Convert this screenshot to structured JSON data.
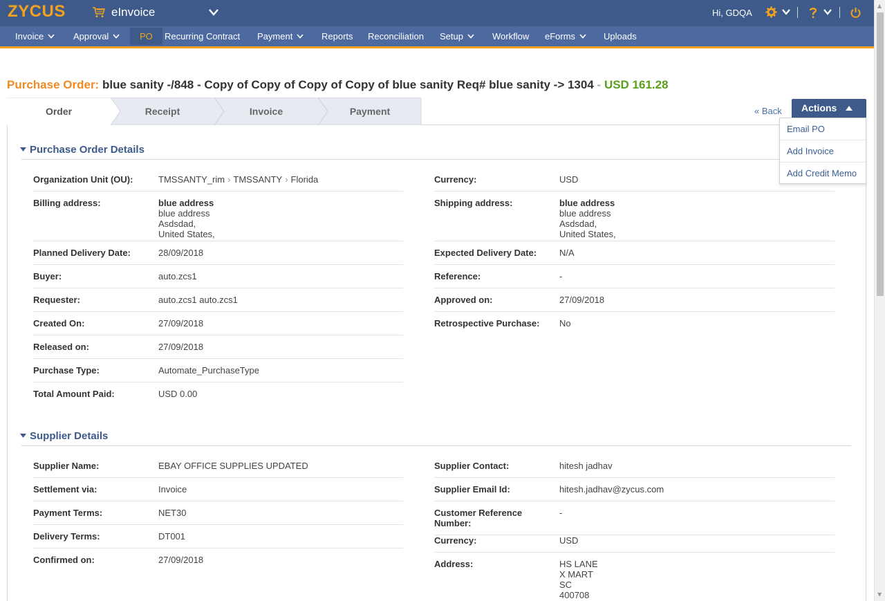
{
  "header": {
    "logo": "ZYCUS",
    "product": "eInvoice",
    "greeting": "Hi, GDQA"
  },
  "nav": {
    "items": [
      {
        "label": "Invoice"
      },
      {
        "label": "Approval"
      },
      {
        "label": "PO"
      },
      {
        "label": "Recurring Contract"
      },
      {
        "label": "Payment"
      },
      {
        "label": "Reports"
      },
      {
        "label": "Reconciliation"
      },
      {
        "label": "Setup"
      },
      {
        "label": "Workflow"
      },
      {
        "label": "eForms"
      },
      {
        "label": "Uploads"
      }
    ]
  },
  "title": {
    "label": "Purchase Order:",
    "name": "blue sanity -/848 - Copy of Copy of Copy of Copy of blue sanity Req# blue sanity -> 1304",
    "separator": "-",
    "amount": "USD 161.28"
  },
  "tabs": [
    {
      "label": "Order"
    },
    {
      "label": "Receipt"
    },
    {
      "label": "Invoice"
    },
    {
      "label": "Payment"
    }
  ],
  "back_link": "« Back",
  "actions": {
    "label": "Actions",
    "menu": [
      {
        "label": "Email PO"
      },
      {
        "label": "Add Invoice"
      },
      {
        "label": "Add Credit Memo"
      }
    ]
  },
  "po_details": {
    "heading": "Purchase Order Details",
    "org_unit": {
      "label": "Organization Unit (OU):",
      "parts": [
        "TMSSANTY_rim",
        "TMSSANTY",
        "Florida"
      ],
      "sep": "›"
    },
    "billing": {
      "label": "Billing address:",
      "lines": [
        "blue address",
        "blue address",
        "Asdsdad,",
        "United States,"
      ]
    },
    "planned_delivery": {
      "label": "Planned Delivery Date:",
      "value": "28/09/2018"
    },
    "buyer": {
      "label": "Buyer:",
      "value": "auto.zcs1"
    },
    "requester": {
      "label": "Requester:",
      "value": "auto.zcs1 auto.zcs1"
    },
    "created_on": {
      "label": "Created On:",
      "value": "27/09/2018"
    },
    "released_on": {
      "label": "Released on:",
      "value": "27/09/2018"
    },
    "purchase_type": {
      "label": "Purchase Type:",
      "value": "Automate_PurchaseType"
    },
    "total_paid": {
      "label": "Total Amount Paid:",
      "value": "USD 0.00"
    },
    "currency": {
      "label": "Currency:",
      "value": "USD"
    },
    "shipping": {
      "label": "Shipping address:",
      "lines": [
        "blue address",
        "blue address",
        "Asdsdad,",
        "United States,"
      ]
    },
    "expected_delivery": {
      "label": "Expected Delivery Date:",
      "value": "N/A"
    },
    "reference": {
      "label": "Reference:",
      "value": "-"
    },
    "approved_on": {
      "label": "Approved on:",
      "value": "27/09/2018"
    },
    "retrospective": {
      "label": "Retrospective Purchase:",
      "value": "No"
    }
  },
  "supplier": {
    "heading": "Supplier Details",
    "name": {
      "label": "Supplier Name:",
      "value": "EBAY OFFICE SUPPLIES UPDATED"
    },
    "settlement": {
      "label": "Settlement via:",
      "value": "Invoice"
    },
    "payment_terms": {
      "label": "Payment Terms:",
      "value": "NET30"
    },
    "delivery_terms": {
      "label": "Delivery Terms:",
      "value": "DT001"
    },
    "confirmed_on": {
      "label": "Confirmed on:",
      "value": "27/09/2018"
    },
    "contact": {
      "label": "Supplier Contact:",
      "value": "hitesh jadhav"
    },
    "email": {
      "label": "Supplier Email Id:",
      "value": "hitesh.jadhav@zycus.com"
    },
    "customer_ref": {
      "label_line1": "Customer Reference",
      "label_line2": "Number:",
      "value": "-"
    },
    "currency": {
      "label": "Currency:",
      "value": "USD"
    },
    "address": {
      "label": "Address:",
      "lines": [
        "HS LANE",
        "X MART",
        "SC",
        "400708"
      ]
    }
  },
  "colors": {
    "header_bg": "#3d5a8a",
    "nav_bg": "#4d6aa0",
    "accent_orange": "#f4a21e",
    "amount_green": "#5a9e1a",
    "link_blue": "#3a5f94"
  }
}
